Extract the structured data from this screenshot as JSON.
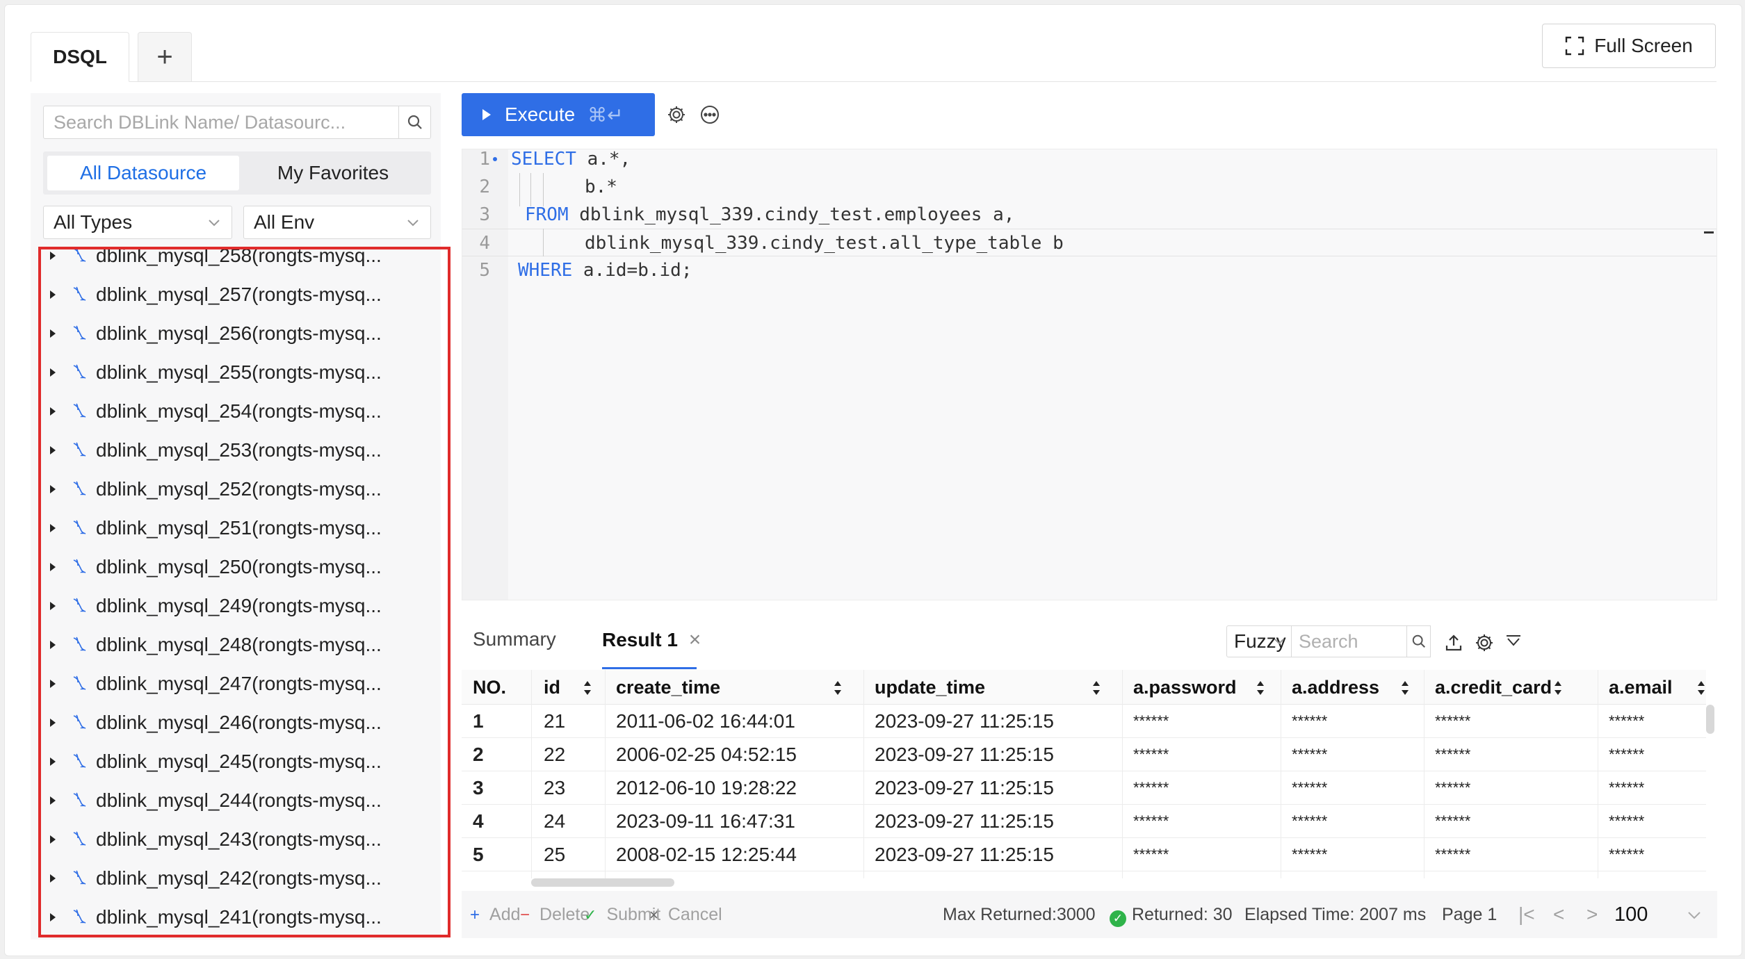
{
  "tabs": {
    "active_label": "DSQL",
    "add_label": "+"
  },
  "header": {
    "fullscreen_label": "Full Screen"
  },
  "sidebar": {
    "search_placeholder": "Search DBLink Name/ Datasourc...",
    "segments": {
      "all": "All Datasource",
      "favorites": "My Favorites"
    },
    "type_filter": "All Types",
    "env_filter": "All Env",
    "items": [
      "dblink_mysql_258(rongts-mysq...",
      "dblink_mysql_257(rongts-mysq...",
      "dblink_mysql_256(rongts-mysq...",
      "dblink_mysql_255(rongts-mysq...",
      "dblink_mysql_254(rongts-mysq...",
      "dblink_mysql_253(rongts-mysq...",
      "dblink_mysql_252(rongts-mysq...",
      "dblink_mysql_251(rongts-mysq...",
      "dblink_mysql_250(rongts-mysq...",
      "dblink_mysql_249(rongts-mysq...",
      "dblink_mysql_248(rongts-mysq...",
      "dblink_mysql_247(rongts-mysq...",
      "dblink_mysql_246(rongts-mysq...",
      "dblink_mysql_245(rongts-mysq...",
      "dblink_mysql_244(rongts-mysq...",
      "dblink_mysql_243(rongts-mysq...",
      "dblink_mysql_242(rongts-mysq...",
      "dblink_mysql_241(rongts-mysq..."
    ]
  },
  "toolbar": {
    "execute_label": "Execute",
    "execute_shortcut": "⌘↵"
  },
  "editor": {
    "lines": [
      {
        "n": "1",
        "kw": "SELECT",
        "rest": " a.*,"
      },
      {
        "n": "2",
        "kw": "",
        "rest": "b.*"
      },
      {
        "n": "3",
        "kw": "FROM",
        "rest": " dblink_mysql_339.cindy_test.employees a,"
      },
      {
        "n": "4",
        "kw": "",
        "rest": "dblink_mysql_339.cindy_test.all_type_table b"
      },
      {
        "n": "5",
        "kw": "WHERE",
        "rest": " a.id=b.id;"
      }
    ]
  },
  "results": {
    "tabs": {
      "summary": "Summary",
      "result": "Result 1"
    },
    "match_mode": "Fuzzy",
    "search_placeholder": "Search",
    "columns": [
      "NO.",
      "id",
      "create_time",
      "update_time",
      "a.password",
      "a.address",
      "a.credit_card",
      "a.email"
    ],
    "rows": [
      [
        "1",
        "21",
        "2011-06-02 16:44:01",
        "2023-09-27 11:25:15",
        "******",
        "******",
        "******",
        "******"
      ],
      [
        "2",
        "22",
        "2006-02-25 04:52:15",
        "2023-09-27 11:25:15",
        "******",
        "******",
        "******",
        "******"
      ],
      [
        "3",
        "23",
        "2012-06-10 19:28:22",
        "2023-09-27 11:25:15",
        "******",
        "******",
        "******",
        "******"
      ],
      [
        "4",
        "24",
        "2023-09-11 16:47:31",
        "2023-09-27 11:25:15",
        "******",
        "******",
        "******",
        "******"
      ],
      [
        "5",
        "25",
        "2008-02-15 12:25:44",
        "2023-09-27 11:25:15",
        "******",
        "******",
        "******",
        "******"
      ]
    ],
    "footer": {
      "add": "Add",
      "delete": "Delete",
      "submit": "Submit",
      "cancel": "Cancel",
      "max_returned": "Max Returned:3000",
      "returned": "Returned: 30",
      "elapsed": "Elapsed Time: 2007 ms",
      "page": "Page 1",
      "page_size": "100"
    }
  },
  "colors": {
    "accent": "#2f6ee6",
    "highlight_border": "#e02b2b",
    "success": "#2fb34a"
  }
}
